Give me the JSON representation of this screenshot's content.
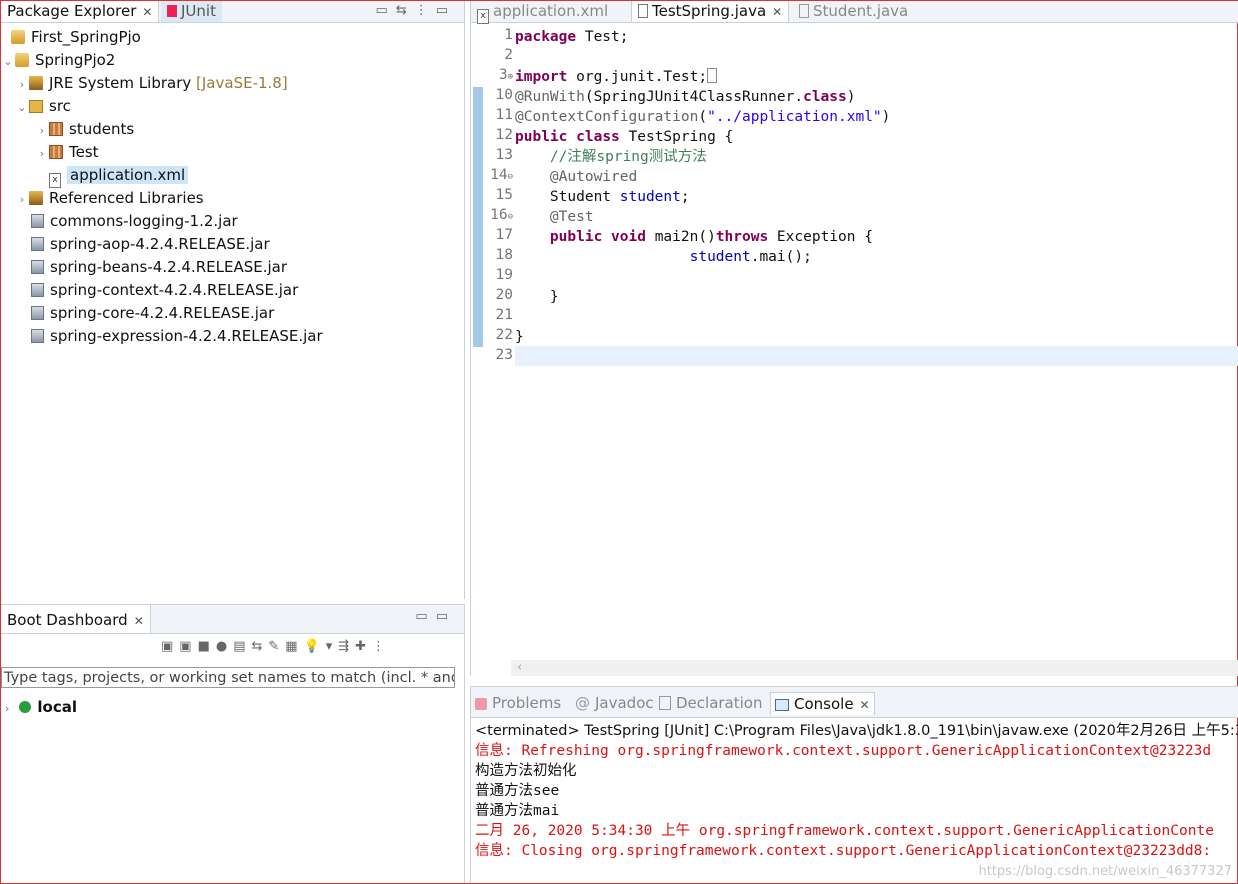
{
  "package_explorer": {
    "tabs": [
      {
        "label": "Package Explorer"
      },
      {
        "label": "JUnit"
      }
    ],
    "tree": [
      {
        "label": "First_SpringPjo"
      },
      {
        "label": "SpringPjo2"
      },
      {
        "label": "JRE System Library",
        "suffix": "[JavaSE-1.8]"
      },
      {
        "label": "src"
      },
      {
        "label": "students"
      },
      {
        "label": "Test"
      },
      {
        "label": "application.xml"
      },
      {
        "label": "Referenced Libraries"
      },
      {
        "label": "commons-logging-1.2.jar"
      },
      {
        "label": "spring-aop-4.2.4.RELEASE.jar"
      },
      {
        "label": "spring-beans-4.2.4.RELEASE.jar"
      },
      {
        "label": "spring-context-4.2.4.RELEASE.jar"
      },
      {
        "label": "spring-core-4.2.4.RELEASE.jar"
      },
      {
        "label": "spring-expression-4.2.4.RELEASE.jar"
      }
    ]
  },
  "boot_dashboard": {
    "tab_label": "Boot Dashboard",
    "filter_placeholder": "Type tags, projects, or working set names to match (incl. * and",
    "local_label": "local"
  },
  "editor": {
    "tabs": [
      {
        "label": "application.xml"
      },
      {
        "label": "TestSpring.java"
      },
      {
        "label": "Student.java"
      }
    ],
    "line_numbers": [
      "1",
      "2",
      "3",
      "10",
      "11",
      "12",
      "13",
      "14",
      "15",
      "16",
      "17",
      "18",
      "19",
      "20",
      "21",
      "22",
      "23"
    ],
    "code": {
      "l1_kw": "package",
      "l1_rest": " Test;",
      "l3_kw": "import",
      "l3_rest": " org.junit.Test;",
      "l10_ann": "@RunWith",
      "l10_a": "(SpringJUnit4ClassRunner.",
      "l10_kw": "class",
      "l10_b": ")",
      "l11_ann": "@ContextConfiguration",
      "l11_a": "(",
      "l11_str": "\"../application.xml\"",
      "l11_b": ")",
      "l12_kw1": "public",
      "l12_kw2": "class",
      "l12_rest": " TestSpring {",
      "l13_cmt": "//注解spring测试方法",
      "l14_ann": "@Autowired",
      "l15_a": "Student ",
      "l15_fld": "student",
      "l15_b": ";",
      "l16_ann": "@Test",
      "l17_kw1": "public",
      "l17_kw2": "void",
      "l17_a": " mai2n()",
      "l17_kw3": "throws",
      "l17_b": " Exception {",
      "l18_fld": "student",
      "l18_b": ".mai();",
      "l20": "}",
      "l22": "}"
    }
  },
  "console": {
    "tabs": [
      {
        "label": "Problems"
      },
      {
        "label": "Javadoc"
      },
      {
        "label": "Declaration"
      },
      {
        "label": "Console"
      }
    ],
    "header": "<terminated> TestSpring [JUnit] C:\\Program Files\\Java\\jdk1.8.0_191\\bin\\javaw.exe (2020年2月26日 上午5:3",
    "lines": [
      {
        "text": "信息: Refreshing org.springframework.context.support.GenericApplicationContext@23223d",
        "color": "#dd1111"
      },
      {
        "text": "构造方法初始化",
        "color": "#111111"
      },
      {
        "text": "普通方法see",
        "color": "#111111"
      },
      {
        "text": "普通方法mai",
        "color": "#111111"
      },
      {
        "text": "二月 26, 2020 5:34:30 上午 org.springframework.context.support.GenericApplicationConte",
        "color": "#dd1111"
      },
      {
        "text": "信息: Closing org.springframework.context.support.GenericApplicationContext@23223dd8:",
        "color": "#dd1111"
      }
    ],
    "watermark": "https://blog.csdn.net/weixin_46377327"
  }
}
